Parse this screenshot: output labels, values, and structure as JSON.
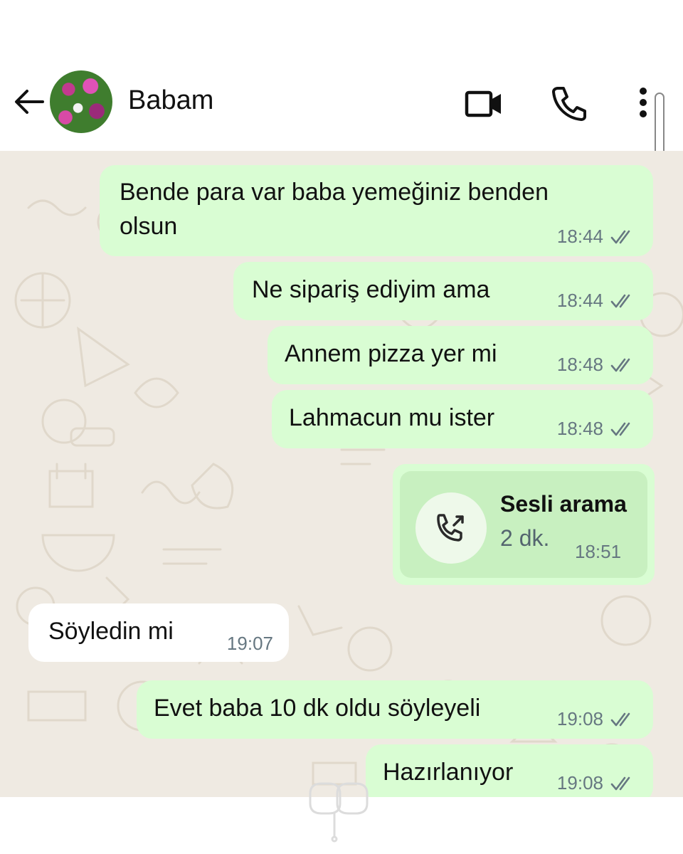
{
  "header": {
    "contact_name": "Babam",
    "icons": [
      "back-arrow-icon",
      "video-call-icon",
      "voice-call-icon",
      "more-options-icon"
    ]
  },
  "colors": {
    "chat_background": "#efeae2",
    "outgoing_bubble": "#d9fdd3",
    "incoming_bubble": "#ffffff",
    "meta_text": "#667781",
    "read_ticks": "#667781"
  },
  "messages": [
    {
      "direction": "outgoing",
      "text": "Bende para var baba yemeğiniz benden\nolsun",
      "time": "18:44",
      "status": "read"
    },
    {
      "direction": "outgoing",
      "text": "Ne sipariş ediyim ama",
      "time": "18:44",
      "status": "read"
    },
    {
      "direction": "outgoing",
      "text": "Annem pizza yer mi",
      "time": "18:48",
      "status": "read"
    },
    {
      "direction": "outgoing",
      "text": "Lahmacun mu ister",
      "time": "18:48",
      "status": "read"
    },
    {
      "direction": "outgoing",
      "type": "call",
      "title": "Sesli arama",
      "duration": "2 dk.",
      "time": "18:51"
    },
    {
      "direction": "incoming",
      "text": "Söyledin mi",
      "time": "19:07"
    },
    {
      "direction": "outgoing",
      "text": "Evet baba 10 dk oldu söyleyeli",
      "time": "19:08",
      "status": "read"
    },
    {
      "direction": "outgoing",
      "text": "Hazırlanıyor",
      "time": "19:08",
      "status": "read"
    }
  ]
}
